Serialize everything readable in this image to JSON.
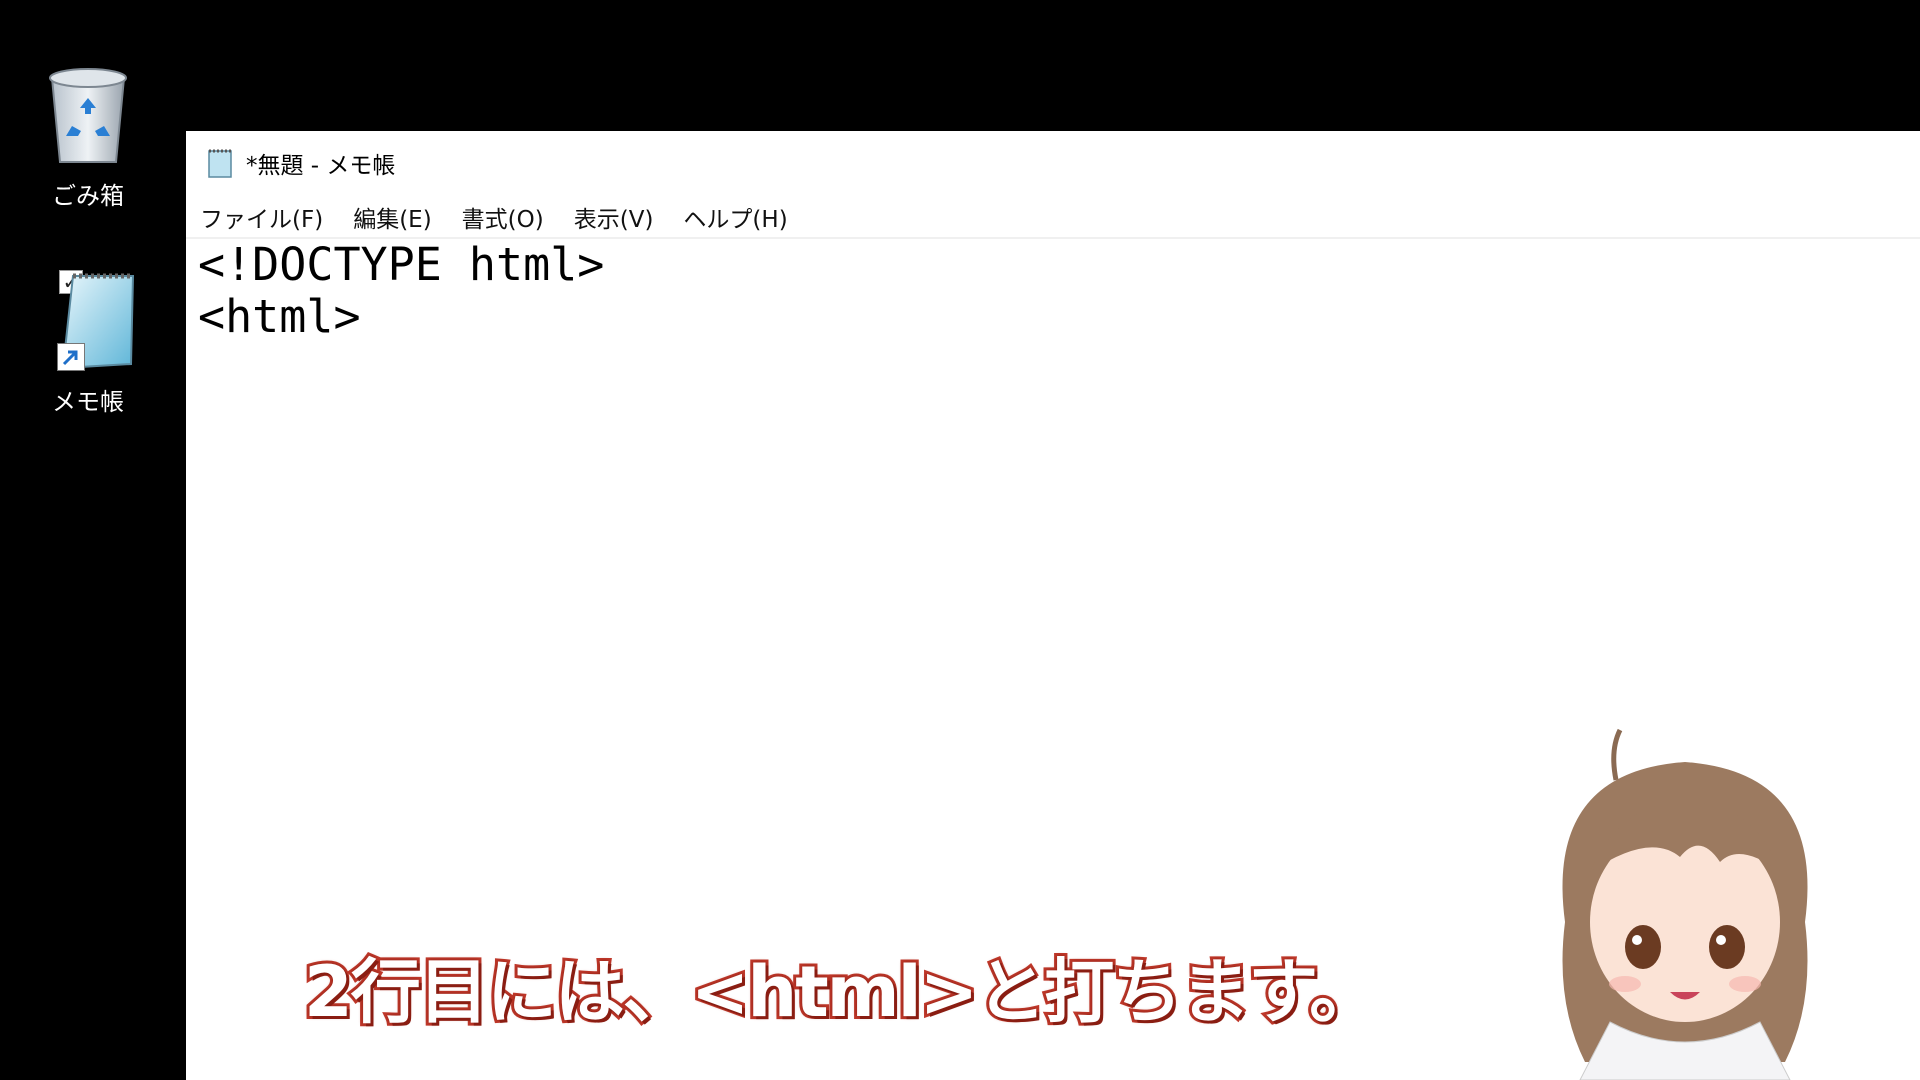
{
  "desktop": {
    "icons": [
      {
        "label": "ごみ箱",
        "icon": "recycle-bin-icon"
      },
      {
        "label": "メモ帳",
        "icon": "notepad-shortcut-icon",
        "checked": true
      }
    ]
  },
  "window": {
    "title": "*無題 - メモ帳",
    "icon": "notepad-icon",
    "menu": [
      "ファイル(F)",
      "編集(E)",
      "書式(O)",
      "表示(V)",
      "ヘルプ(H)"
    ],
    "content_lines": [
      "<!DOCTYPE html>",
      "<html>"
    ]
  },
  "caption": {
    "text": "2行目には、<html>と打ちます。",
    "fill_color": "#ffffff",
    "stroke_color": "#c0392b"
  },
  "avatar": {
    "icon": "vtuber-avatar"
  }
}
